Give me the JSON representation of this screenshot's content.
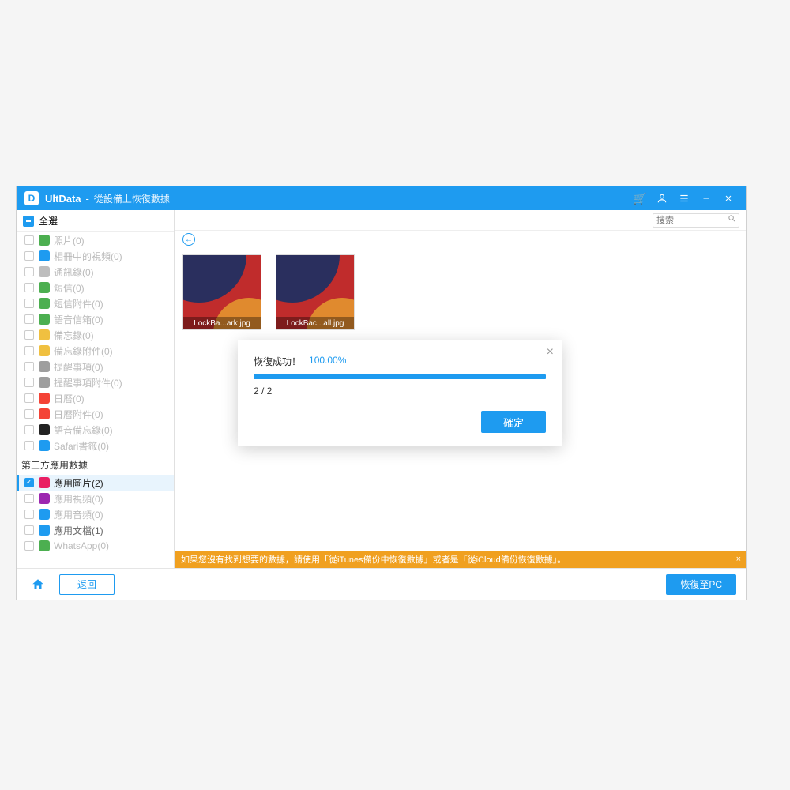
{
  "titlebar": {
    "app_name": "UltData",
    "separator": "-",
    "subtitle": "從設備上恢復數據"
  },
  "select_all": {
    "label": "全選"
  },
  "sidebar": {
    "items": [
      {
        "label": "照片(0)",
        "checked": false,
        "icon_color": "#4caf50"
      },
      {
        "label": "相冊中的視頻(0)",
        "checked": false,
        "icon_color": "#1e9bf0"
      },
      {
        "label": "通訊錄(0)",
        "checked": false,
        "icon_color": "#bdbdbd"
      },
      {
        "label": "短信(0)",
        "checked": false,
        "icon_color": "#4caf50"
      },
      {
        "label": "短信附件(0)",
        "checked": false,
        "icon_color": "#4caf50"
      },
      {
        "label": "語音信箱(0)",
        "checked": false,
        "icon_color": "#4caf50"
      },
      {
        "label": "備忘錄(0)",
        "checked": false,
        "icon_color": "#f0c040"
      },
      {
        "label": "備忘錄附件(0)",
        "checked": false,
        "icon_color": "#f0c040"
      },
      {
        "label": "提醒事項(0)",
        "checked": false,
        "icon_color": "#9e9e9e"
      },
      {
        "label": "提醒事項附件(0)",
        "checked": false,
        "icon_color": "#9e9e9e"
      },
      {
        "label": "日曆(0)",
        "checked": false,
        "icon_color": "#f44336"
      },
      {
        "label": "日曆附件(0)",
        "checked": false,
        "icon_color": "#f44336"
      },
      {
        "label": "語音備忘錄(0)",
        "checked": false,
        "icon_color": "#222222"
      },
      {
        "label": "Safari書籤(0)",
        "checked": false,
        "icon_color": "#1e9bf0"
      }
    ],
    "section2_title": "第三方應用數據",
    "items2": [
      {
        "label": "應用圖片(2)",
        "checked": true,
        "selected": true,
        "icon_color": "#e91e63"
      },
      {
        "label": "應用視頻(0)",
        "checked": false,
        "icon_color": "#9c27b0"
      },
      {
        "label": "應用音頻(0)",
        "checked": false,
        "icon_color": "#1e9bf0"
      },
      {
        "label": "應用文檔(1)",
        "checked": false,
        "enabled": true,
        "icon_color": "#1e9bf0"
      },
      {
        "label": "WhatsApp(0)",
        "checked": false,
        "icon_color": "#4caf50"
      }
    ]
  },
  "search": {
    "placeholder": "搜索"
  },
  "thumbs": [
    {
      "caption": "LockBa...ark.jpg"
    },
    {
      "caption": "LockBac...all.jpg"
    }
  ],
  "banner": {
    "text": "如果您沒有找到想要的數據，請使用「從iTunes備份中恢復數據」或者是「從iCloud備份恢復數據」。"
  },
  "footer": {
    "back_label": "返回",
    "recover_label": "恢復至PC"
  },
  "modal": {
    "status_label": "恢復成功！",
    "percent": "100.00%",
    "count": "2 / 2",
    "ok_label": "確定"
  }
}
